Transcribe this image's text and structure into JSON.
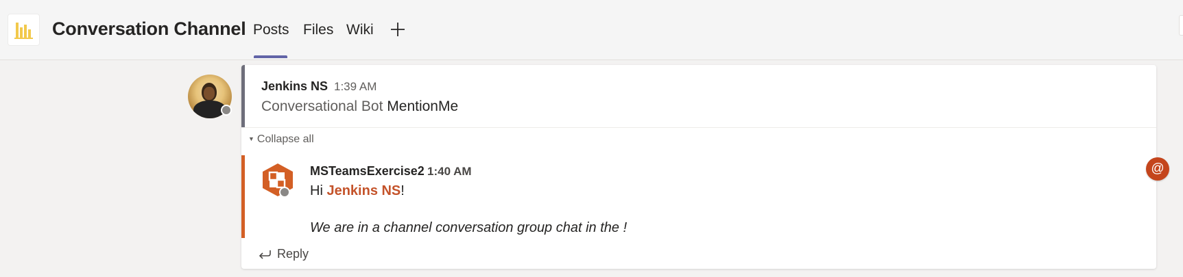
{
  "header": {
    "channel_title": "Conversation Channel",
    "app_icon": "bar-chart-icon",
    "tabs": [
      {
        "label": "Posts",
        "active": true
      },
      {
        "label": "Files",
        "active": false
      },
      {
        "label": "Wiki",
        "active": false
      }
    ],
    "add_tab_icon": "plus-icon",
    "accent_color": "#6264a7"
  },
  "thread": {
    "root": {
      "author": "Jenkins NS",
      "time": "1:39 AM",
      "mention_tag": "Conversational Bot",
      "text": "MentionMe",
      "avatar_icon": "user-photo"
    },
    "collapse_label": "Collapse all",
    "reply": {
      "author": "MSTeamsExercise2",
      "time": "1:40 AM",
      "greeting_prefix": "Hi ",
      "greeting_mention": "Jenkins NS",
      "greeting_suffix": "!",
      "message": "We are in a channel conversation group chat in the !",
      "bot_icon": "app-hexagon-icon",
      "accent_color": "#d35f25"
    },
    "reply_label": "Reply"
  },
  "mention_badge": {
    "symbol": "@",
    "color": "#c4451c"
  }
}
